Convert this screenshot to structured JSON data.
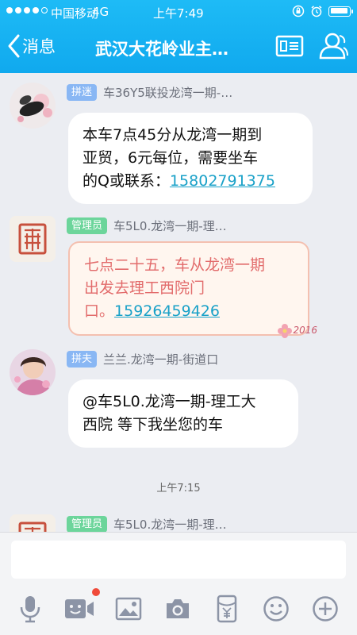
{
  "status_bar": {
    "carrier": "中国移动",
    "network": "4G",
    "time": "上午7:49"
  },
  "nav": {
    "back_label": "消息",
    "title": "武汉大花岭业主…"
  },
  "messages": [
    {
      "badge": "拼迷",
      "badge_color": "#89b7f4",
      "sender": "车36Y5联投龙湾一期-…",
      "line1": "本车7点45分从龙湾一期到",
      "line2": "亚贸，6元每位，需要坐车",
      "line3_prefix": "的Q或联系：",
      "phone": "15802791375"
    },
    {
      "badge": "管理员",
      "badge_color": "#6cd59b",
      "sender": "车5L0.龙湾一期-理…",
      "line1": "七点二十五，车从龙湾一期",
      "line2": "出发去理工西院门",
      "line3_prefix": "口。",
      "phone": "15926459426",
      "decoration": "2016"
    },
    {
      "badge": "拼夫",
      "badge_color": "#89b7f4",
      "sender": "兰兰.龙湾一期-街道口",
      "line1": "@车5L0.龙湾一期-理工大",
      "line2": "西院 等下我坐您的车"
    }
  ],
  "time_separator": "上午7:15",
  "partial_message": {
    "badge": "管理员",
    "sender": "车5L0.龙湾一期-理…"
  },
  "input": {
    "value": "",
    "placeholder": ""
  },
  "toolbar_icons": [
    "microphone-icon",
    "video-icon",
    "image-icon",
    "camera-icon",
    "red-packet-icon",
    "emoji-icon",
    "plus-icon"
  ],
  "colors": {
    "header": "#12aaef",
    "link": "#19a1c8",
    "icon": "#8c94a6",
    "notification": "#f04a3a"
  }
}
